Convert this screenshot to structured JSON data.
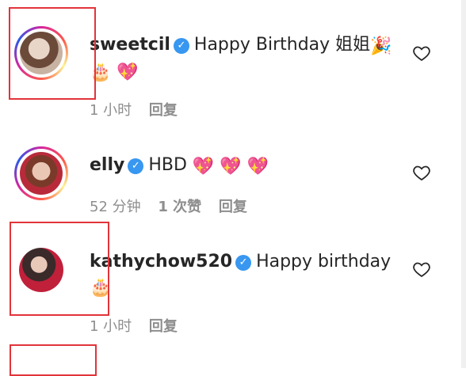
{
  "comments": [
    {
      "username": "sweetcil",
      "verified": true,
      "text": "Happy Birthday 姐姐",
      "emojis_inline": "🎉",
      "emojis_line2": "🎂 💖",
      "time": "1 小时",
      "reply": "回复",
      "likes": ""
    },
    {
      "username": "elly",
      "verified": true,
      "text": "HBD",
      "emojis_inline": "💖 💖 💖",
      "emojis_line2": "",
      "time": "52 分钟",
      "likes": "1 次赞",
      "reply": "回复"
    },
    {
      "username": "kathychow520",
      "verified": true,
      "text": "Happy birthday",
      "emojis_inline": "",
      "emojis_line2": "🎂",
      "time": "1 小时",
      "reply": "回复",
      "likes": ""
    }
  ],
  "icons": {
    "verified": "verified-badge-icon",
    "heart": "heart-outline-icon"
  },
  "colors": {
    "verified_blue": "#3897f0",
    "meta_gray": "#8e8e8e",
    "annotation_red": "#e2343a",
    "text": "#262626"
  }
}
